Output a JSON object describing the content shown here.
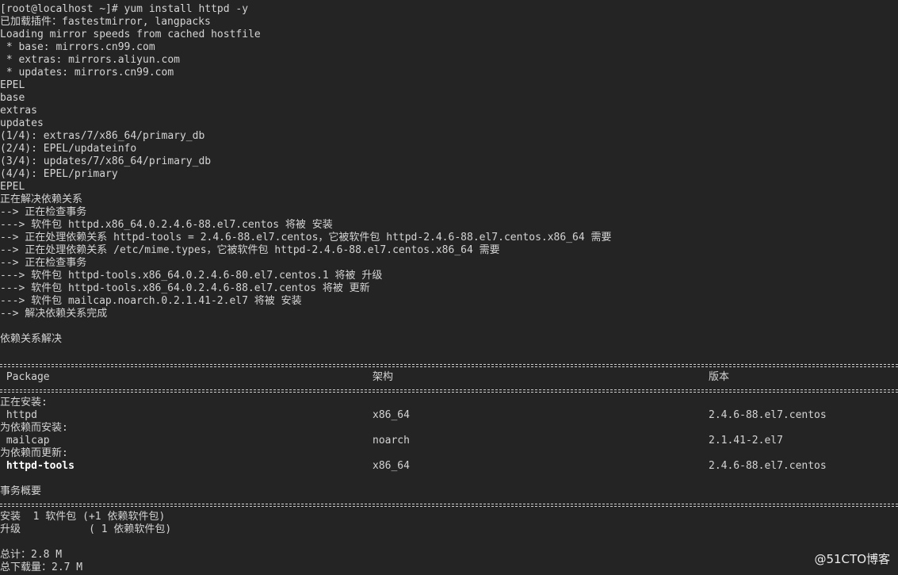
{
  "terminal": {
    "lines_top": [
      "[root@localhost ~]# yum install httpd -y",
      "已加载插件：fastestmirror, langpacks",
      "Loading mirror speeds from cached hostfile",
      " * base: mirrors.cn99.com",
      " * extras: mirrors.aliyun.com",
      " * updates: mirrors.cn99.com",
      "EPEL",
      "base",
      "extras",
      "updates",
      "(1/4): extras/7/x86_64/primary_db",
      "(2/4): EPEL/updateinfo",
      "(3/4): updates/7/x86_64/primary_db",
      "(4/4): EPEL/primary",
      "EPEL",
      "正在解决依赖关系",
      "--> 正在检查事务",
      "---> 软件包 httpd.x86_64.0.2.4.6-88.el7.centos 将被 安装",
      "--> 正在处理依赖关系 httpd-tools = 2.4.6-88.el7.centos，它被软件包 httpd-2.4.6-88.el7.centos.x86_64 需要",
      "--> 正在处理依赖关系 /etc/mime.types，它被软件包 httpd-2.4.6-88.el7.centos.x86_64 需要",
      "--> 正在检查事务",
      "---> 软件包 httpd-tools.x86_64.0.2.4.6-80.el7.centos.1 将被 升级",
      "---> 软件包 httpd-tools.x86_64.0.2.4.6-88.el7.centos 将被 更新",
      "---> 软件包 mailcap.noarch.0.2.1.41-2.el7 将被 安装",
      "--> 解决依赖关系完成",
      "",
      "依赖关系解决"
    ],
    "table": {
      "headers": [
        " Package",
        "架构",
        "版本"
      ],
      "installing_label": "正在安装:",
      "dep_install_label": "为依赖而安装:",
      "dep_update_label": "为依赖而更新:",
      "rows": [
        {
          "package": " httpd",
          "arch": "x86_64",
          "version": "2.4.6-88.el7.centos"
        },
        {
          "package": " mailcap",
          "arch": "noarch",
          "version": "2.1.41-2.el7"
        },
        {
          "package": " httpd-tools",
          "arch": "x86_64",
          "version": "2.4.6-88.el7.centos"
        }
      ]
    },
    "summary": {
      "title": "事务概要",
      "install_line": "安装  1 软件包 (+1 依赖软件包)",
      "upgrade_line": "升级           ( 1 依赖软件包)",
      "total_line": "总计：2.8 M",
      "download_line": "总下载量：2.7 M"
    }
  },
  "watermark": "@51CTO博客"
}
